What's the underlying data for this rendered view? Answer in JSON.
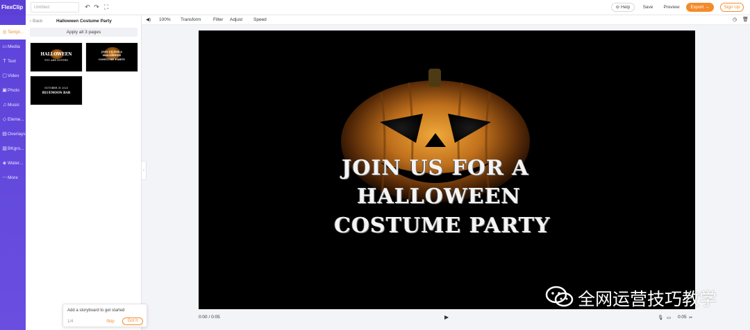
{
  "app": {
    "logo": "FlexClip",
    "project_title_placeholder": "Untitled"
  },
  "topbar": {
    "help_label": "Help",
    "save_label": "Save",
    "preview_label": "Preview",
    "export_label": "Export",
    "signup_label": "Sign Up"
  },
  "rail": {
    "items": [
      {
        "label": "Templ...",
        "icon": "template-icon",
        "glyph": "◎"
      },
      {
        "label": "Media",
        "icon": "media-icon",
        "glyph": "▭"
      },
      {
        "label": "Text",
        "icon": "text-icon",
        "glyph": "T"
      },
      {
        "label": "Video",
        "icon": "video-icon",
        "glyph": "▢"
      },
      {
        "label": "Photo",
        "icon": "photo-icon",
        "glyph": "▣"
      },
      {
        "label": "Music",
        "icon": "music-icon",
        "glyph": "♫"
      },
      {
        "label": "Eleme...",
        "icon": "element-icon",
        "glyph": "◇"
      },
      {
        "label": "Overlays",
        "icon": "overlay-icon",
        "glyph": "▤"
      },
      {
        "label": "BKgro...",
        "icon": "background-icon",
        "glyph": "▥"
      },
      {
        "label": "Water...",
        "icon": "watermark-icon",
        "glyph": "◈"
      },
      {
        "label": "More",
        "icon": "more-icon",
        "glyph": "⋯"
      }
    ]
  },
  "panel": {
    "back_label": "Back",
    "title": "Halloween Costume Party",
    "apply_label": "Apply all 3 pages",
    "thumbs": [
      {
        "line1": "HALLOWEEN",
        "line2": "YOU ARE INVITED"
      },
      {
        "line1": "JOIN US FOR A",
        "line2": "HALLOWEEN",
        "line3": "COSTUME PARTY"
      },
      {
        "line1": "OCTOBER 31 2023",
        "line2": "BLUEMOON BAR"
      }
    ],
    "tip": {
      "text": "Add a storyboard to get started",
      "count": "1/4",
      "skip_label": "Skip",
      "got_label": "Got It"
    }
  },
  "toolbar": {
    "zoom": "100%",
    "transform_label": "Transform",
    "filter_label": "Filter",
    "adjust_label": "Adjust",
    "speed_label": "Speed"
  },
  "stage": {
    "line1": "Join us for a",
    "line2": "Halloween",
    "line3": "Costume Party"
  },
  "playbar": {
    "time": "0:00 / 0:05",
    "duration": "0:05"
  },
  "watermark": {
    "text": "全网运营技巧教学"
  },
  "colors": {
    "brand": "#5b3fd6",
    "accent": "#f38b2c",
    "stage_bg": "#000000"
  }
}
